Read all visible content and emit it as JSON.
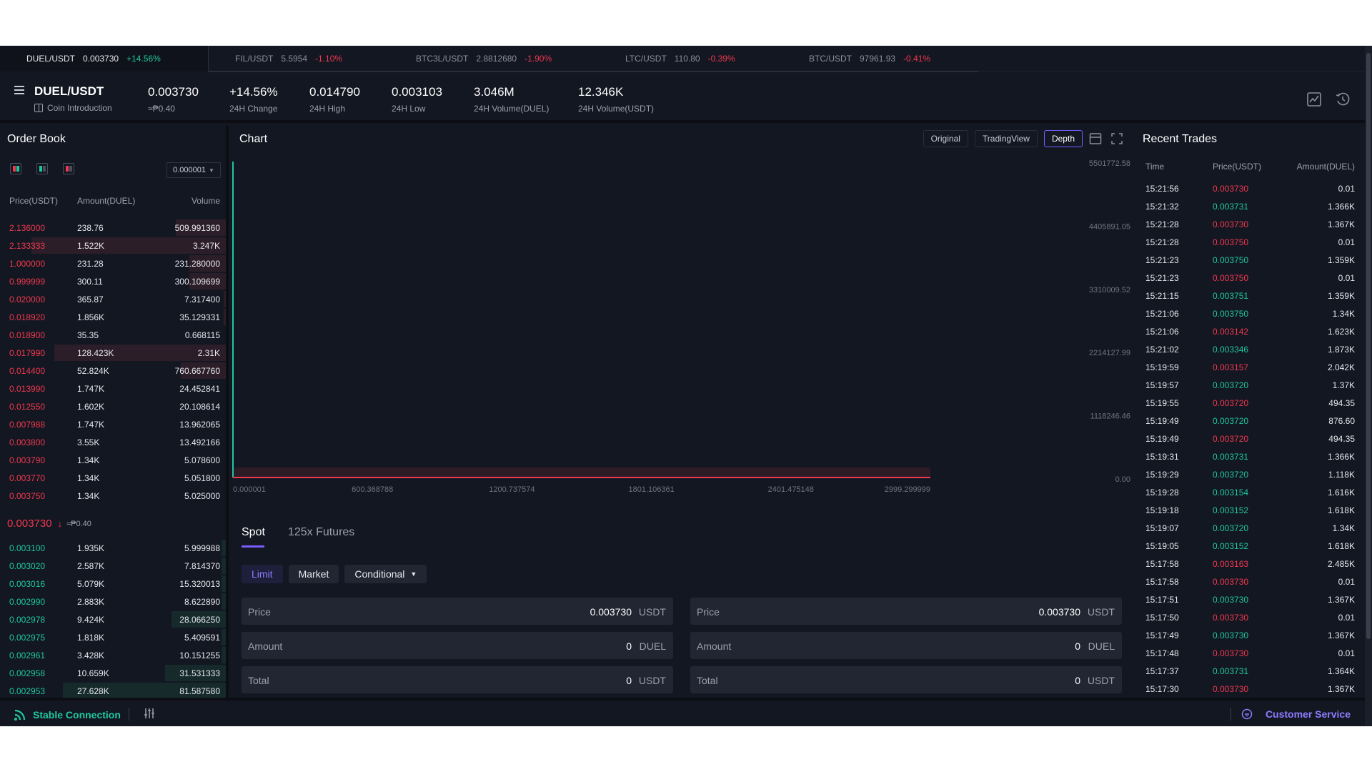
{
  "ticker": {
    "current": {
      "symbol": "DUEL/USDT",
      "price": "0.003730",
      "change": "+14.56%"
    },
    "items": [
      {
        "symbol": "FIL/USDT",
        "price": "5.5954",
        "change": "-1.10%"
      },
      {
        "symbol": "BTC3L/USDT",
        "price": "2.8812680",
        "change": "-1.90%"
      },
      {
        "symbol": "LTC/USDT",
        "price": "110.80",
        "change": "-0.39%"
      },
      {
        "symbol": "BTC/USDT",
        "price": "97961.93",
        "change": "-0.41%"
      }
    ]
  },
  "header": {
    "pair": "DUEL/USDT",
    "coin_intro": "Coin Introduction",
    "price": "0.003730",
    "approx": "≈₱0.40",
    "stats": [
      {
        "value": "+14.56%",
        "label": "24H Change"
      },
      {
        "value": "0.014790",
        "label": "24H High"
      },
      {
        "value": "0.003103",
        "label": "24H Low"
      },
      {
        "value": "3.046M",
        "label": "24H Volume(DUEL)"
      },
      {
        "value": "12.346K",
        "label": "24H Volume(USDT)"
      }
    ]
  },
  "orderbook": {
    "title": "Order Book",
    "precision": "0.000001",
    "headers": {
      "price": "Price(USDT)",
      "amount": "Amount(DUEL)",
      "volume": "Volume"
    },
    "asks": [
      {
        "price": "2.136000",
        "amount": "238.76",
        "volume": "509.991360",
        "depth": 0.22
      },
      {
        "price": "2.133333",
        "amount": "1.522K",
        "volume": "3.247K",
        "depth": 0.86
      },
      {
        "price": "1.000000",
        "amount": "231.28",
        "volume": "231.280000",
        "depth": 0.16
      },
      {
        "price": "0.999999",
        "amount": "300.11",
        "volume": "300.109699",
        "depth": 0.16
      },
      {
        "price": "0.020000",
        "amount": "365.87",
        "volume": "7.317400",
        "depth": 0.01
      },
      {
        "price": "0.018920",
        "amount": "1.856K",
        "volume": "35.129331",
        "depth": 0.01
      },
      {
        "price": "0.018900",
        "amount": "35.35",
        "volume": "0.668115",
        "depth": 0.0
      },
      {
        "price": "0.017990",
        "amount": "128.423K",
        "volume": "2.31K",
        "depth": 0.76
      },
      {
        "price": "0.014400",
        "amount": "52.824K",
        "volume": "760.667760",
        "depth": 0.2
      },
      {
        "price": "0.013990",
        "amount": "1.747K",
        "volume": "24.452841",
        "depth": 0.0
      },
      {
        "price": "0.012550",
        "amount": "1.602K",
        "volume": "20.108614",
        "depth": 0.0
      },
      {
        "price": "0.007988",
        "amount": "1.747K",
        "volume": "13.962065",
        "depth": 0.0
      },
      {
        "price": "0.003800",
        "amount": "3.55K",
        "volume": "13.492166",
        "depth": 0.0
      },
      {
        "price": "0.003790",
        "amount": "1.34K",
        "volume": "5.078600",
        "depth": 0.0
      },
      {
        "price": "0.003770",
        "amount": "1.34K",
        "volume": "5.051800",
        "depth": 0.0
      },
      {
        "price": "0.003750",
        "amount": "1.34K",
        "volume": "5.025000",
        "depth": 0.0
      }
    ],
    "mid": {
      "price": "0.003730",
      "arrow": "↓",
      "approx": "≈₱0.40"
    },
    "bids": [
      {
        "price": "0.003100",
        "amount": "1.935K",
        "volume": "5.999988",
        "depth": 0.02
      },
      {
        "price": "0.003020",
        "amount": "2.587K",
        "volume": "7.814370",
        "depth": 0.02
      },
      {
        "price": "0.003016",
        "amount": "5.079K",
        "volume": "15.320013",
        "depth": 0.02
      },
      {
        "price": "0.002990",
        "amount": "2.883K",
        "volume": "8.622890",
        "depth": 0.02
      },
      {
        "price": "0.002978",
        "amount": "9.424K",
        "volume": "28.066250",
        "depth": 0.24
      },
      {
        "price": "0.002975",
        "amount": "1.818K",
        "volume": "5.409591",
        "depth": 0.02
      },
      {
        "price": "0.002961",
        "amount": "3.428K",
        "volume": "10.151255",
        "depth": 0.02
      },
      {
        "price": "0.002958",
        "amount": "10.659K",
        "volume": "31.531333",
        "depth": 0.27
      },
      {
        "price": "0.002953",
        "amount": "27.628K",
        "volume": "81.587580",
        "depth": 0.72
      }
    ]
  },
  "chart": {
    "title": "Chart",
    "tools": [
      "Original",
      "TradingView",
      "Depth"
    ],
    "active_tool": "Depth"
  },
  "chart_data": {
    "type": "area",
    "title": "",
    "xlabel": "",
    "ylabel": "",
    "x_ticks": [
      "0.000001",
      "600.368788",
      "1200.737574",
      "1801.106361",
      "2401.475148",
      "2999.299999"
    ],
    "y_ticks": [
      "5501772.58",
      "4405891.05",
      "3310009.52",
      "2214127.99",
      "1118246.46",
      "0.00"
    ],
    "xlim": [
      1e-06,
      2999.299999
    ],
    "ylim": [
      0,
      5501772.58
    ],
    "series": [
      {
        "color": "#1fc7a0",
        "points": [
          [
            1e-06,
            0
          ],
          [
            0.00373,
            5501772.58
          ]
        ]
      },
      {
        "color": "#f0384e",
        "points": [
          [
            0.00375,
            0
          ],
          [
            2999.299999,
            0
          ]
        ]
      }
    ],
    "grid": false
  },
  "trade": {
    "tabs": [
      "Spot",
      "125x Futures"
    ],
    "active_tab": "Spot",
    "types": [
      "Limit",
      "Market",
      "Conditional"
    ],
    "active_type": "Limit",
    "buy": [
      {
        "label": "Price",
        "value": "0.003730",
        "unit": "USDT"
      },
      {
        "label": "Amount",
        "value": "0",
        "unit": "DUEL"
      },
      {
        "label": "Total",
        "value": "0",
        "unit": "USDT"
      }
    ],
    "sell": [
      {
        "label": "Price",
        "value": "0.003730",
        "unit": "USDT"
      },
      {
        "label": "Amount",
        "value": "0",
        "unit": "DUEL"
      },
      {
        "label": "Total",
        "value": "0",
        "unit": "USDT"
      }
    ]
  },
  "trades": {
    "title": "Recent Trades",
    "headers": {
      "time": "Time",
      "price": "Price(USDT)",
      "amount": "Amount(DUEL)"
    },
    "rows": [
      {
        "time": "15:21:56",
        "price": "0.003730",
        "amount": "0.01",
        "side": "sell"
      },
      {
        "time": "15:21:32",
        "price": "0.003731",
        "amount": "1.366K",
        "side": "buy"
      },
      {
        "time": "15:21:28",
        "price": "0.003730",
        "amount": "1.367K",
        "side": "sell"
      },
      {
        "time": "15:21:28",
        "price": "0.003750",
        "amount": "0.01",
        "side": "sell"
      },
      {
        "time": "15:21:23",
        "price": "0.003750",
        "amount": "1.359K",
        "side": "buy"
      },
      {
        "time": "15:21:23",
        "price": "0.003750",
        "amount": "0.01",
        "side": "sell"
      },
      {
        "time": "15:21:15",
        "price": "0.003751",
        "amount": "1.359K",
        "side": "buy"
      },
      {
        "time": "15:21:06",
        "price": "0.003750",
        "amount": "1.34K",
        "side": "buy"
      },
      {
        "time": "15:21:06",
        "price": "0.003142",
        "amount": "1.623K",
        "side": "sell"
      },
      {
        "time": "15:21:02",
        "price": "0.003346",
        "amount": "1.873K",
        "side": "buy"
      },
      {
        "time": "15:19:59",
        "price": "0.003157",
        "amount": "2.042K",
        "side": "sell"
      },
      {
        "time": "15:19:57",
        "price": "0.003720",
        "amount": "1.37K",
        "side": "buy"
      },
      {
        "time": "15:19:55",
        "price": "0.003720",
        "amount": "494.35",
        "side": "sell"
      },
      {
        "time": "15:19:49",
        "price": "0.003720",
        "amount": "876.60",
        "side": "buy"
      },
      {
        "time": "15:19:49",
        "price": "0.003720",
        "amount": "494.35",
        "side": "sell"
      },
      {
        "time": "15:19:31",
        "price": "0.003731",
        "amount": "1.366K",
        "side": "buy"
      },
      {
        "time": "15:19:29",
        "price": "0.003720",
        "amount": "1.118K",
        "side": "buy"
      },
      {
        "time": "15:19:28",
        "price": "0.003154",
        "amount": "1.616K",
        "side": "buy"
      },
      {
        "time": "15:19:18",
        "price": "0.003152",
        "amount": "1.618K",
        "side": "buy"
      },
      {
        "time": "15:19:07",
        "price": "0.003720",
        "amount": "1.34K",
        "side": "buy"
      },
      {
        "time": "15:19:05",
        "price": "0.003152",
        "amount": "1.618K",
        "side": "buy"
      },
      {
        "time": "15:17:58",
        "price": "0.003163",
        "amount": "2.485K",
        "side": "sell"
      },
      {
        "time": "15:17:58",
        "price": "0.003730",
        "amount": "0.01",
        "side": "sell"
      },
      {
        "time": "15:17:51",
        "price": "0.003730",
        "amount": "1.367K",
        "side": "buy"
      },
      {
        "time": "15:17:50",
        "price": "0.003730",
        "amount": "0.01",
        "side": "sell"
      },
      {
        "time": "15:17:49",
        "price": "0.003730",
        "amount": "1.367K",
        "side": "buy"
      },
      {
        "time": "15:17:48",
        "price": "0.003730",
        "amount": "0.01",
        "side": "sell"
      },
      {
        "time": "15:17:37",
        "price": "0.003731",
        "amount": "1.364K",
        "side": "buy"
      },
      {
        "time": "15:17:30",
        "price": "0.003730",
        "amount": "1.367K",
        "side": "sell"
      }
    ]
  },
  "footer": {
    "connection": "Stable Connection",
    "customer_service": "Customer Service"
  },
  "colors": {
    "up": "#1fc7a0",
    "down": "#f0384e",
    "accent": "#7a5cff"
  },
  "icons": [
    "menu-icon",
    "book-icon",
    "candle-chart-icon",
    "history-icon",
    "layout-icon",
    "fullscreen-icon",
    "signal-icon",
    "sliders-icon",
    "chat-icon"
  ]
}
